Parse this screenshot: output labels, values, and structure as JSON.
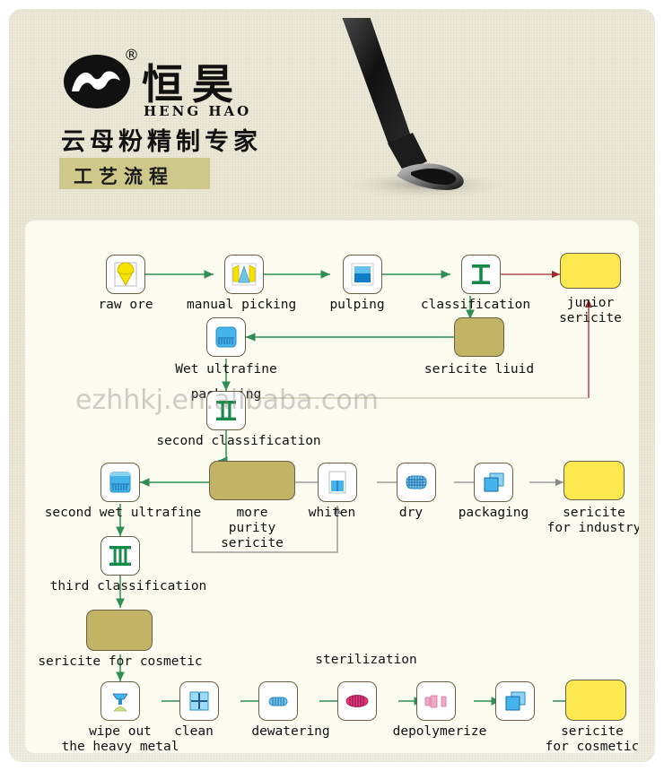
{
  "header": {
    "logo_mark": "hh-logo-icon",
    "brand_cn": "恒昊",
    "registered_mark": "®",
    "brand_en": "HENG  HAO",
    "tagline_cn": "云母粉精制专家",
    "title_cn": "工艺流程",
    "brush_icon": "ink-brush-icon"
  },
  "watermark": {
    "text": "ezhhkj.en.alibaba.com"
  },
  "colors": {
    "panel_bg": "#ece9d8",
    "canvas_bg": "#fbfbef",
    "node_border": "#6b6046",
    "arrow_green": "#2f8f52",
    "arrow_grey": "#8a8a8a",
    "arrow_red": "#9e2f2f",
    "product_yellow": "#fbe94f",
    "product_olive": "#c2b464",
    "title_chip": "#cfc88b"
  },
  "flow": {
    "nodes": [
      {
        "id": "raw-ore",
        "label": "raw ore",
        "kind": "icon",
        "icon": "yellow-fan-ore-icon"
      },
      {
        "id": "manual-picking",
        "label": "manual picking",
        "kind": "icon",
        "icon": "hand-sorting-icon"
      },
      {
        "id": "pulping",
        "label": "pulping",
        "kind": "icon",
        "icon": "blue-tank-icon"
      },
      {
        "id": "classification",
        "label": "classification",
        "kind": "icon",
        "icon": "roman-numeral-one-icon"
      },
      {
        "id": "junior-sericite",
        "label": "junior\nsericite",
        "kind": "product",
        "fill": "yellow"
      },
      {
        "id": "sericite-liuid",
        "label": "sericite liuid",
        "kind": "product",
        "fill": "olive"
      },
      {
        "id": "wet-ultrafine",
        "label": "Wet ultrafine",
        "kind": "icon",
        "icon": "blue-grinder-icon"
      },
      {
        "id": "packaging-1",
        "label": "packaging",
        "kind": "text"
      },
      {
        "id": "second-classification",
        "label": "second classification",
        "kind": "icon",
        "icon": "roman-numeral-two-icon"
      },
      {
        "id": "second-wet-ultrafine",
        "label": "second wet ultrafine",
        "kind": "icon",
        "icon": "blue-grinder-icon"
      },
      {
        "id": "more-purity-sericite",
        "label": "more\npurity\nsericite",
        "kind": "product",
        "fill": "olive"
      },
      {
        "id": "whiten",
        "label": "whiten",
        "kind": "icon",
        "icon": "beaker-icon"
      },
      {
        "id": "dry",
        "label": "dry",
        "kind": "icon",
        "icon": "mesh-dryer-icon"
      },
      {
        "id": "packaging-2",
        "label": "packaging",
        "kind": "icon",
        "icon": "stacked-boxes-icon"
      },
      {
        "id": "sericite-for-industry",
        "label": "sericite\nfor industry",
        "kind": "product",
        "fill": "yellow"
      },
      {
        "id": "third-classification",
        "label": "third classification",
        "kind": "icon",
        "icon": "roman-numeral-three-icon"
      },
      {
        "id": "sericite-for-cosmetic",
        "label": "sericite for cosmetic",
        "kind": "product",
        "fill": "olive"
      },
      {
        "id": "wipe-out-heavy-metal",
        "label": "wipe out\nthe heavy metal",
        "kind": "icon",
        "icon": "magnet-separator-icon"
      },
      {
        "id": "clean",
        "label": "clean",
        "kind": "icon",
        "icon": "wash-tank-icon"
      },
      {
        "id": "dewatering",
        "label": "dewatering",
        "kind": "icon",
        "icon": "blue-filter-icon"
      },
      {
        "id": "sterilization",
        "label": "sterilization",
        "kind": "icon",
        "icon": "pink-sterilizer-icon"
      },
      {
        "id": "depolymerize",
        "label": "depolymerize",
        "kind": "icon",
        "icon": "pink-depolymerizer-icon"
      },
      {
        "id": "packaging-3",
        "label": "packaging",
        "kind": "icon",
        "icon": "stacked-boxes-icon"
      },
      {
        "id": "sericite-for-cosmetic-final",
        "label": "sericite\nfor cosmetic",
        "kind": "product",
        "fill": "yellow"
      }
    ]
  }
}
